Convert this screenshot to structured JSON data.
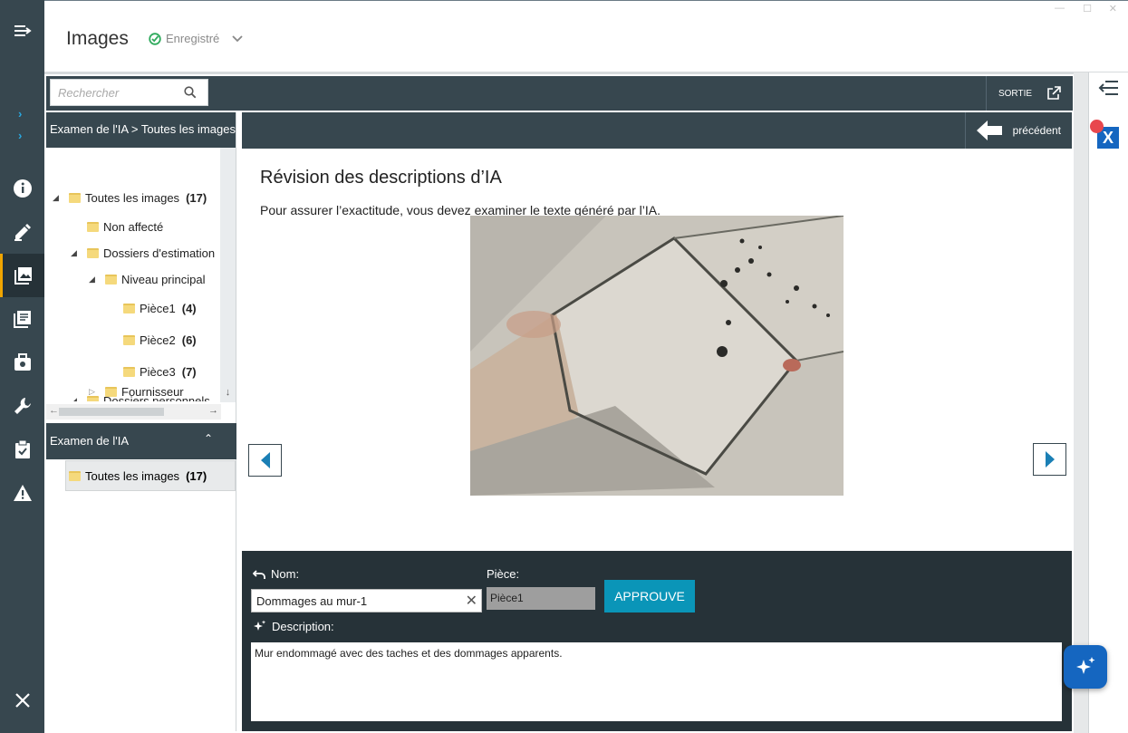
{
  "header": {
    "title": "Images",
    "status": "Enregistré"
  },
  "search": {
    "placeholder": "Rechercher"
  },
  "toolbar": {
    "exit_label": "SORTIE"
  },
  "left_panel": {
    "breadcrumb": "Examen de l'IA > Toutes les images",
    "tree": [
      {
        "label": "Toutes les images",
        "count": "(17)"
      },
      {
        "label": "Non affecté",
        "count": ""
      },
      {
        "label": "Dossiers d'estimation",
        "count": ""
      },
      {
        "label": "Niveau principal",
        "count": ""
      },
      {
        "label": "Pièce1",
        "count": "(4)"
      },
      {
        "label": "Pièce2",
        "count": "(6)"
      },
      {
        "label": "Pièce3",
        "count": "(7)"
      },
      {
        "label": "Dossiers personnels",
        "count": ""
      },
      {
        "label": "Fournisseur",
        "count": ""
      }
    ],
    "section2_title": "Examen de l'IA",
    "section2_item": {
      "label": "Toutes les images",
      "count": "(17)"
    }
  },
  "main": {
    "previous_label": "précédent",
    "title": "Révision des descriptions d’IA",
    "description": "Pour assurer l’exactitude, vous devez examiner le texte généré par l’IA."
  },
  "form": {
    "name_label": "Nom:",
    "name_value": "Dommages au mur-1",
    "room_label": "Pièce:",
    "room_value": "Pièce1",
    "approve_label": "APPROUVE",
    "description_label": "Description:",
    "description_value": "Mur endommagé avec des taches et des dommages apparents."
  },
  "colors": {
    "rail": "#37474f",
    "dark_bar": "#37474f",
    "form_bg": "#263238",
    "accent": "#0a95b8",
    "active_indicator": "#f0a500",
    "status_check": "#2eaa5c"
  }
}
